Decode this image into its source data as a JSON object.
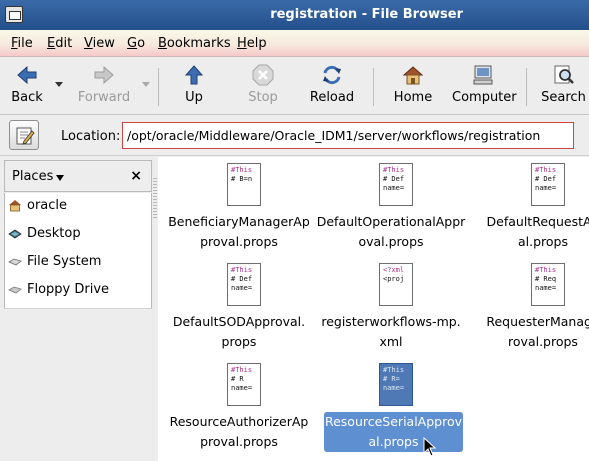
{
  "window": {
    "title": "registration - File Browser"
  },
  "menu": [
    {
      "label": "File",
      "accel": "F",
      "rest": "ile"
    },
    {
      "label": "Edit",
      "accel": "E",
      "rest": "dit"
    },
    {
      "label": "View",
      "accel": "V",
      "rest": "iew"
    },
    {
      "label": "Go",
      "accel": "G",
      "rest": "o"
    },
    {
      "label": "Bookmarks",
      "accel": "B",
      "rest": "ookmarks"
    },
    {
      "label": "Help",
      "accel": "H",
      "rest": "elp"
    }
  ],
  "toolbar": {
    "back": "Back",
    "forward": "Forward",
    "up": "Up",
    "stop": "Stop",
    "reload": "Reload",
    "home": "Home",
    "computer": "Computer",
    "search": "Search"
  },
  "location": {
    "label": "Location:",
    "value": "/opt/oracle/Middleware/Oracle_IDM1/server/workflows/registration"
  },
  "sidebar": {
    "header": "Places",
    "close": "×",
    "items": [
      {
        "label": "oracle",
        "icon": "home-folder-icon"
      },
      {
        "label": "Desktop",
        "icon": "desktop-icon"
      },
      {
        "label": "File System",
        "icon": "drive-icon"
      },
      {
        "label": "Floppy Drive",
        "icon": "floppy-icon"
      }
    ]
  },
  "files": [
    {
      "line1": "BeneficiaryManagerAp",
      "line2": "proval.props",
      "preview": [
        "#This",
        "# B=n",
        ""
      ]
    },
    {
      "line1": "DefaultOperationalAppr",
      "line2": "oval.props",
      "preview": [
        "#This",
        "# Def",
        "name="
      ]
    },
    {
      "line1": "DefaultRequestAp",
      "line2": "al.props",
      "preview": [
        "#This",
        "# Def",
        "name="
      ]
    },
    {
      "line1": "DefaultSODApproval.",
      "line2": "props",
      "preview": [
        "#This",
        "# Def",
        "name="
      ]
    },
    {
      "line1": "registerworkflows-mp.",
      "line2": "xml",
      "preview": [
        "<?xml",
        "<proj",
        ""
      ]
    },
    {
      "line1": "RequesterManage",
      "line2": "roval.props",
      "preview": [
        "#This",
        "# Req",
        "name="
      ]
    },
    {
      "line1": "ResourceAuthorizerAp",
      "line2": "proval.props",
      "preview": [
        "#This",
        "# R",
        "name="
      ]
    },
    {
      "line1": "ResourceSerialApprov",
      "line2": "al.props",
      "preview": [
        "#This",
        "# R=",
        "name="
      ],
      "selected": true
    }
  ],
  "colors": {
    "titlebar": "#2e5c9a",
    "selection": "#5e8fd0",
    "location_border": "#cc4444"
  }
}
